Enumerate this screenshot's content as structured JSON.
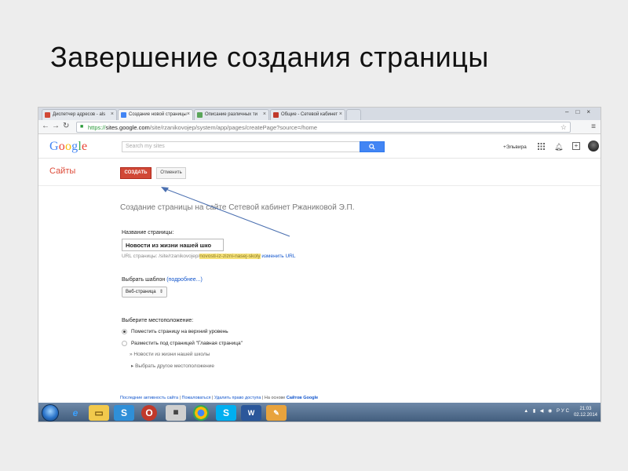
{
  "slide": {
    "title": "Завершение создания страницы"
  },
  "browser": {
    "tabs": [
      {
        "label": "Диспетчер адресов - als",
        "active": false,
        "icon": "gmail-icon",
        "color": "#d14836"
      },
      {
        "label": "Создание новой страницы",
        "active": true,
        "icon": "sites-icon",
        "color": "#4285f4"
      },
      {
        "label": "Описание различных ти",
        "active": false,
        "icon": "page-icon",
        "color": "#5aa55a"
      },
      {
        "label": "Общие - Сетевой кабинет",
        "active": false,
        "icon": "shield-icon",
        "color": "#c0392b"
      }
    ],
    "url": {
      "scheme": "https://",
      "host": "sites.google.com",
      "path": "/site/rzanikovojep/system/app/pages/createPage?source=/home"
    }
  },
  "google": {
    "logo": "Google",
    "logo_colors": [
      "#4285f4",
      "#ea4335",
      "#fbbc05",
      "#4285f4",
      "#34a853",
      "#ea4335"
    ],
    "search_placeholder": "Search my sites",
    "user": "+Эльвира"
  },
  "sites": {
    "title": "Сайты",
    "create_label": "СОЗДАТЬ",
    "cancel_label": "Отменить"
  },
  "form": {
    "heading": "Создание страницы на сайте Сетевой кабинет Ржаниковой Э.П.",
    "name_label": "Название страницы:",
    "name_value": "Новости из жизни нашей шко",
    "url_prefix": "URL страницы: /site/rzanikovojep/",
    "url_slug": "novosti-iz-zizni-nasej-skoly",
    "url_change": "изменить URL",
    "template_label": "Выбрать шаблон",
    "template_more": "(подробнее...)",
    "template_value": "Веб-страница",
    "location_label": "Выберите местоположение:",
    "options": [
      {
        "label": "Поместить страницу на верхний уровень",
        "selected": true
      },
      {
        "label": "Разместить под страницей \"Главная страница\"",
        "selected": false
      }
    ],
    "sub_items": [
      "» Новости из жизни нашей школы",
      "▸ Выбрать другое местоположение"
    ]
  },
  "footer": {
    "items": [
      "Последние активность сайта",
      "Пожаловаться",
      "Удалить право доступа"
    ],
    "powered": "На основе",
    "brand": "Сайтов Google"
  },
  "taskbar": {
    "apps": [
      "ie-icon",
      "explorer-icon",
      "skype-icon",
      "opera-icon",
      "chrome-icon",
      "skype-icon",
      "word-icon",
      "paint-icon"
    ],
    "lang": "РУС",
    "time": "21:03",
    "date": "02.12.2014"
  }
}
